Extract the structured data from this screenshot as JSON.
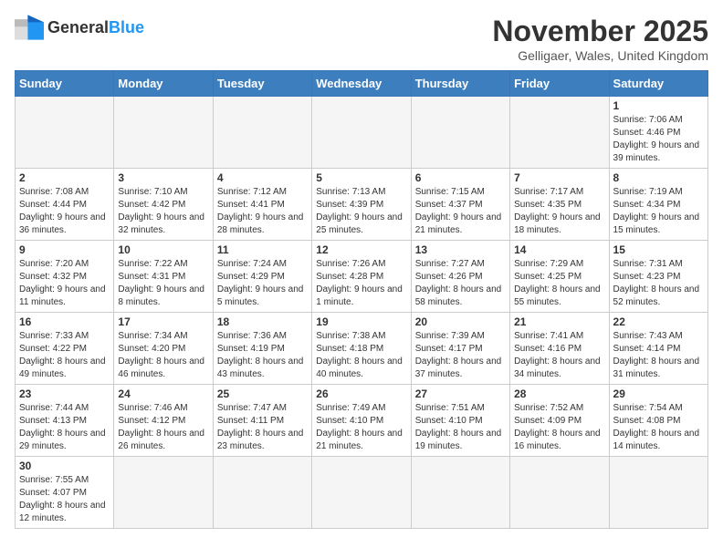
{
  "header": {
    "logo_general": "General",
    "logo_blue": "Blue",
    "title": "November 2025",
    "location": "Gelligaer, Wales, United Kingdom"
  },
  "days_of_week": [
    "Sunday",
    "Monday",
    "Tuesday",
    "Wednesday",
    "Thursday",
    "Friday",
    "Saturday"
  ],
  "weeks": [
    [
      {
        "day": "",
        "info": ""
      },
      {
        "day": "",
        "info": ""
      },
      {
        "day": "",
        "info": ""
      },
      {
        "day": "",
        "info": ""
      },
      {
        "day": "",
        "info": ""
      },
      {
        "day": "",
        "info": ""
      },
      {
        "day": "1",
        "info": "Sunrise: 7:06 AM\nSunset: 4:46 PM\nDaylight: 9 hours and 39 minutes."
      }
    ],
    [
      {
        "day": "2",
        "info": "Sunrise: 7:08 AM\nSunset: 4:44 PM\nDaylight: 9 hours and 36 minutes."
      },
      {
        "day": "3",
        "info": "Sunrise: 7:10 AM\nSunset: 4:42 PM\nDaylight: 9 hours and 32 minutes."
      },
      {
        "day": "4",
        "info": "Sunrise: 7:12 AM\nSunset: 4:41 PM\nDaylight: 9 hours and 28 minutes."
      },
      {
        "day": "5",
        "info": "Sunrise: 7:13 AM\nSunset: 4:39 PM\nDaylight: 9 hours and 25 minutes."
      },
      {
        "day": "6",
        "info": "Sunrise: 7:15 AM\nSunset: 4:37 PM\nDaylight: 9 hours and 21 minutes."
      },
      {
        "day": "7",
        "info": "Sunrise: 7:17 AM\nSunset: 4:35 PM\nDaylight: 9 hours and 18 minutes."
      },
      {
        "day": "8",
        "info": "Sunrise: 7:19 AM\nSunset: 4:34 PM\nDaylight: 9 hours and 15 minutes."
      }
    ],
    [
      {
        "day": "9",
        "info": "Sunrise: 7:20 AM\nSunset: 4:32 PM\nDaylight: 9 hours and 11 minutes."
      },
      {
        "day": "10",
        "info": "Sunrise: 7:22 AM\nSunset: 4:31 PM\nDaylight: 9 hours and 8 minutes."
      },
      {
        "day": "11",
        "info": "Sunrise: 7:24 AM\nSunset: 4:29 PM\nDaylight: 9 hours and 5 minutes."
      },
      {
        "day": "12",
        "info": "Sunrise: 7:26 AM\nSunset: 4:28 PM\nDaylight: 9 hours and 1 minute."
      },
      {
        "day": "13",
        "info": "Sunrise: 7:27 AM\nSunset: 4:26 PM\nDaylight: 8 hours and 58 minutes."
      },
      {
        "day": "14",
        "info": "Sunrise: 7:29 AM\nSunset: 4:25 PM\nDaylight: 8 hours and 55 minutes."
      },
      {
        "day": "15",
        "info": "Sunrise: 7:31 AM\nSunset: 4:23 PM\nDaylight: 8 hours and 52 minutes."
      }
    ],
    [
      {
        "day": "16",
        "info": "Sunrise: 7:33 AM\nSunset: 4:22 PM\nDaylight: 8 hours and 49 minutes."
      },
      {
        "day": "17",
        "info": "Sunrise: 7:34 AM\nSunset: 4:20 PM\nDaylight: 8 hours and 46 minutes."
      },
      {
        "day": "18",
        "info": "Sunrise: 7:36 AM\nSunset: 4:19 PM\nDaylight: 8 hours and 43 minutes."
      },
      {
        "day": "19",
        "info": "Sunrise: 7:38 AM\nSunset: 4:18 PM\nDaylight: 8 hours and 40 minutes."
      },
      {
        "day": "20",
        "info": "Sunrise: 7:39 AM\nSunset: 4:17 PM\nDaylight: 8 hours and 37 minutes."
      },
      {
        "day": "21",
        "info": "Sunrise: 7:41 AM\nSunset: 4:16 PM\nDaylight: 8 hours and 34 minutes."
      },
      {
        "day": "22",
        "info": "Sunrise: 7:43 AM\nSunset: 4:14 PM\nDaylight: 8 hours and 31 minutes."
      }
    ],
    [
      {
        "day": "23",
        "info": "Sunrise: 7:44 AM\nSunset: 4:13 PM\nDaylight: 8 hours and 29 minutes."
      },
      {
        "day": "24",
        "info": "Sunrise: 7:46 AM\nSunset: 4:12 PM\nDaylight: 8 hours and 26 minutes."
      },
      {
        "day": "25",
        "info": "Sunrise: 7:47 AM\nSunset: 4:11 PM\nDaylight: 8 hours and 23 minutes."
      },
      {
        "day": "26",
        "info": "Sunrise: 7:49 AM\nSunset: 4:10 PM\nDaylight: 8 hours and 21 minutes."
      },
      {
        "day": "27",
        "info": "Sunrise: 7:51 AM\nSunset: 4:10 PM\nDaylight: 8 hours and 19 minutes."
      },
      {
        "day": "28",
        "info": "Sunrise: 7:52 AM\nSunset: 4:09 PM\nDaylight: 8 hours and 16 minutes."
      },
      {
        "day": "29",
        "info": "Sunrise: 7:54 AM\nSunset: 4:08 PM\nDaylight: 8 hours and 14 minutes."
      }
    ],
    [
      {
        "day": "30",
        "info": "Sunrise: 7:55 AM\nSunset: 4:07 PM\nDaylight: 8 hours and 12 minutes."
      },
      {
        "day": "",
        "info": ""
      },
      {
        "day": "",
        "info": ""
      },
      {
        "day": "",
        "info": ""
      },
      {
        "day": "",
        "info": ""
      },
      {
        "day": "",
        "info": ""
      },
      {
        "day": "",
        "info": ""
      }
    ]
  ]
}
